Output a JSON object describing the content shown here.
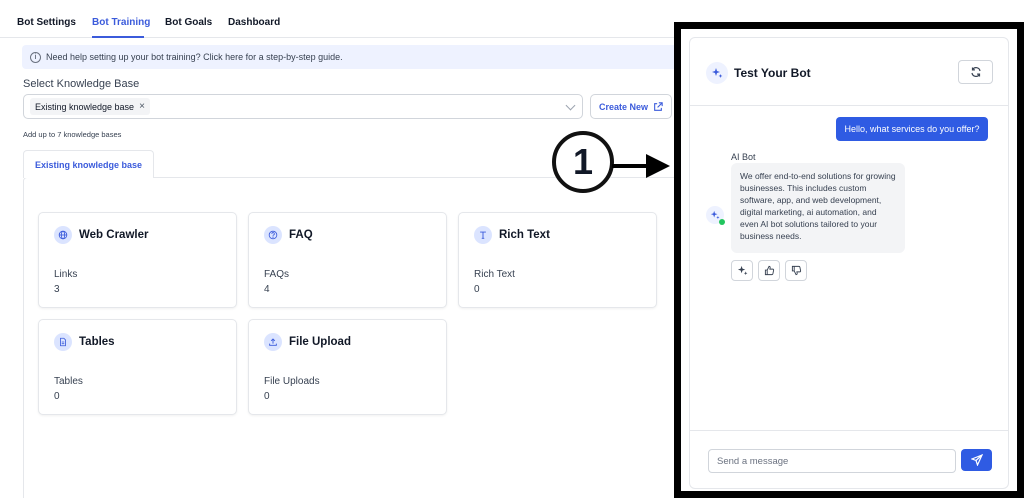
{
  "nav": {
    "tabs": [
      "Bot Settings",
      "Bot Training",
      "Bot Goals",
      "Dashboard"
    ],
    "active_tab": "Bot Training"
  },
  "banner": {
    "text": "Need help setting up your bot training? Click here for a step-by-step guide."
  },
  "knowledge_base": {
    "label": "Select Knowledge Base",
    "selected_chip": "Existing knowledge base",
    "create_button": "Create New",
    "hint": "Add up to 7 knowledge bases",
    "tab": "Existing knowledge base"
  },
  "cards": [
    {
      "title": "Web Crawler",
      "icon": "globe-icon",
      "label": "Links",
      "value": "3"
    },
    {
      "title": "FAQ",
      "icon": "question-icon",
      "label": "FAQs",
      "value": "4"
    },
    {
      "title": "Rich Text",
      "icon": "text-icon",
      "label": "Rich Text",
      "value": "0"
    },
    {
      "title": "Tables",
      "icon": "document-icon",
      "label": "Tables",
      "value": "0"
    },
    {
      "title": "File Upload",
      "icon": "upload-icon",
      "label": "File Uploads",
      "value": "0"
    }
  ],
  "annotation": {
    "number": "1"
  },
  "chat": {
    "title": "Test Your Bot",
    "user_message": "Hello, what services do you offer?",
    "bot_name": "AI Bot",
    "bot_message": "We offer end-to-end solutions for growing businesses. This includes custom software, app, and web development, digital marketing, ai automation, and even AI bot solutions tailored to your business needs.",
    "input_placeholder": "Send a message"
  },
  "colors": {
    "accent": "#2f5be3",
    "tab_active": "#3b5bdb",
    "online": "#22c55e"
  }
}
